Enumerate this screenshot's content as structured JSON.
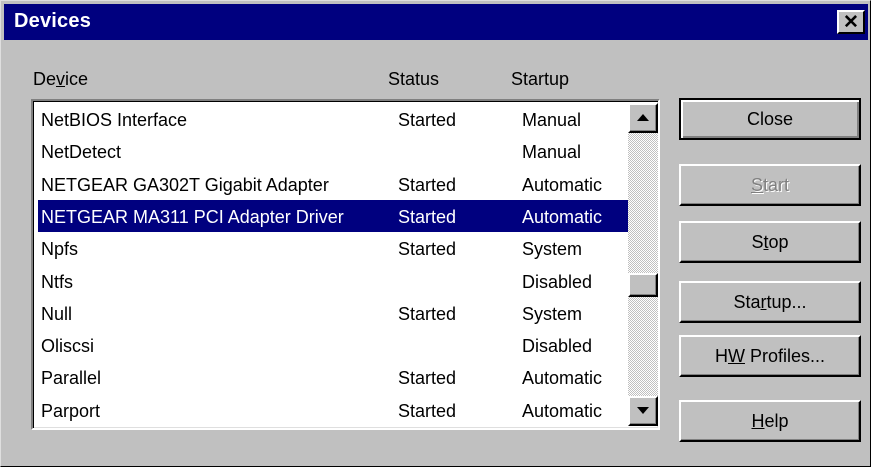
{
  "window": {
    "title": "Devices",
    "close_glyph": "✕"
  },
  "columns": {
    "device": "Device",
    "status": "Status",
    "startup": "Startup"
  },
  "rows": [
    {
      "device": "NetBIOS Interface",
      "status": "Started",
      "startup": "Manual"
    },
    {
      "device": "NetDetect",
      "status": "",
      "startup": "Manual"
    },
    {
      "device": "NETGEAR GA302T Gigabit Adapter",
      "status": "Started",
      "startup": "Automatic"
    },
    {
      "device": "NETGEAR MA311 PCI Adapter Driver",
      "status": "Started",
      "startup": "Automatic",
      "selected": true
    },
    {
      "device": "Npfs",
      "status": "Started",
      "startup": "System"
    },
    {
      "device": "Ntfs",
      "status": "",
      "startup": "Disabled"
    },
    {
      "device": "Null",
      "status": "Started",
      "startup": "System"
    },
    {
      "device": "Oliscsi",
      "status": "",
      "startup": "Disabled"
    },
    {
      "device": "Parallel",
      "status": "Started",
      "startup": "Automatic"
    },
    {
      "device": "Parport",
      "status": "Started",
      "startup": "Automatic"
    }
  ],
  "buttons": {
    "close": "Close",
    "start": "Start",
    "stop": "Stop",
    "startup": "Startup...",
    "hw_profiles": "HW Profiles...",
    "help": "Help"
  },
  "colors": {
    "titlebar": "#00007f",
    "face": "#c0c0c0",
    "selection": "#00007f",
    "disabled_text": "#808080"
  },
  "icons": {
    "scroll_up": "up-arrow-icon",
    "scroll_down": "down-arrow-icon",
    "close": "close-icon"
  }
}
